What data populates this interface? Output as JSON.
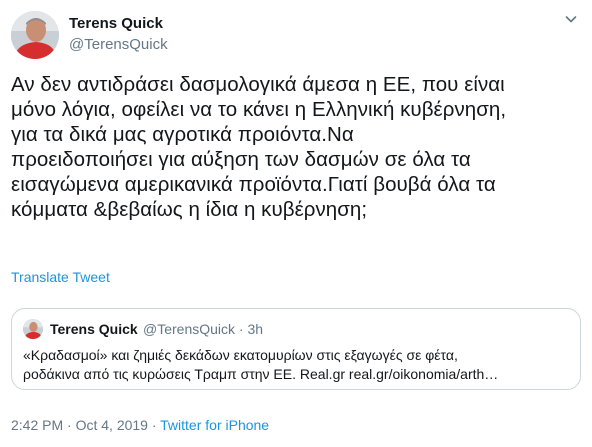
{
  "author": {
    "name": "Terens Quick",
    "handle": "@TerensQuick"
  },
  "tweet": {
    "lines": [
      "Αν δεν αντιδράσει δασμολογικά άμεσα η ΕΕ, που είναι",
      "μόνο λόγια, οφείλει να το κάνει η Ελληνική κυβέρνηση,",
      "για τα δικά μας αγροτικά προιόντα.Να",
      "προειδοποιήσει για αύξηση των δασμών σε όλα τα",
      "εισαγώμενα αμερικανικά προϊόντα.Γιατί βουβά όλα τα",
      "κόμματα &βεβαίως η ίδια η κυβέρνηση;"
    ],
    "translate_label": "Translate Tweet"
  },
  "quoted": {
    "name": "Terens Quick",
    "handle_time": "@TerensQuick · 3h",
    "line1": "«Κραδασμοί» και ζημιές δεκάδων εκατομυρίων στις εξαγωγές σε φέτα,",
    "line2": "ροδάκινα από τις κυρώσεις Τραμπ στην ΕΕ. Real.gr real.gr/oikonomia/arth…"
  },
  "meta": {
    "timestamp": "2:42 PM · Oct 4, 2019 · ",
    "source": "Twitter for iPhone"
  },
  "colors": {
    "link": "#1b95e0",
    "secondary": "#657786",
    "border": "#ccd6dd"
  },
  "icons": {
    "menu": "chevron-down-icon"
  }
}
